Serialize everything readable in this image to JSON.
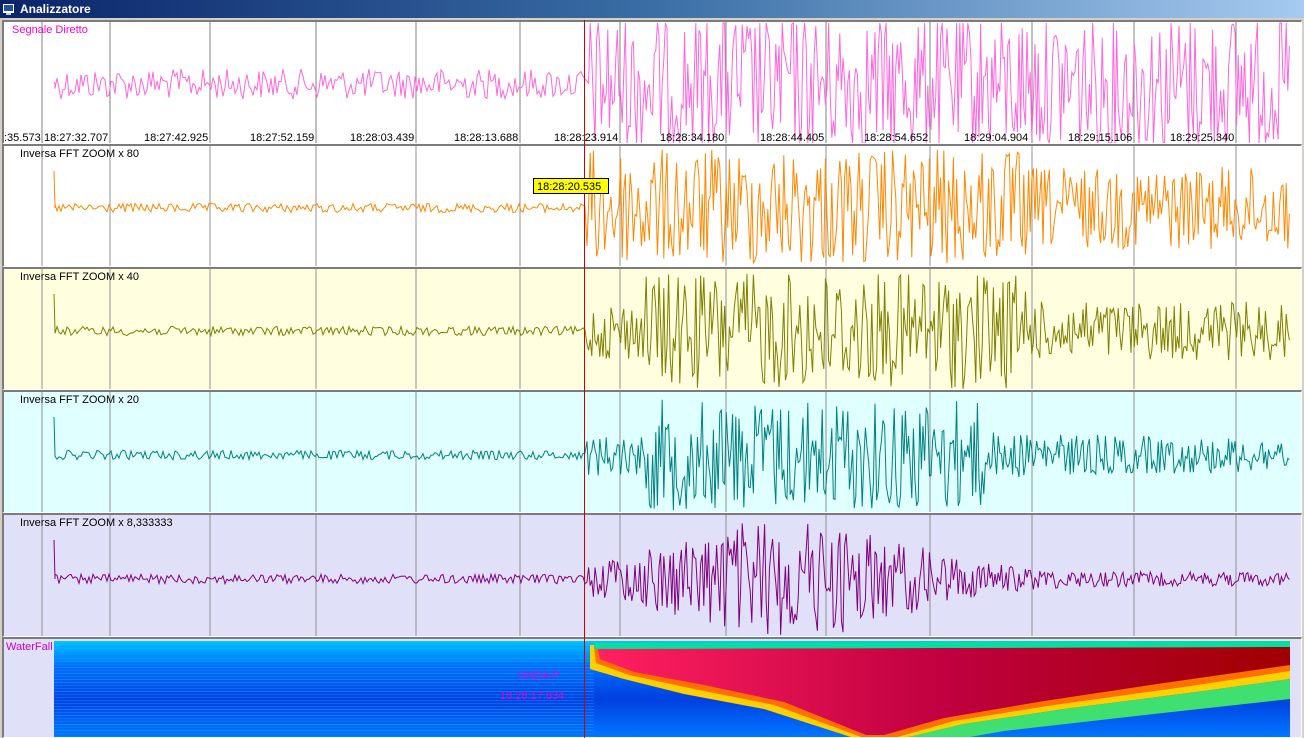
{
  "window": {
    "title": "Analizzatore"
  },
  "marker_time": "18:28:20.535",
  "time_axis": {
    "start_partial": ":35.573",
    "labels": [
      "18:27:32.707",
      "18:27:42.925",
      "18:27:52.159",
      "18:28:03.439",
      "18:28:13.688",
      "18:28:23.914",
      "18:28:34.180",
      "18:28:44.405",
      "18:28:54.652",
      "18:29:04.904",
      "18:29:15.106",
      "18:29:25.340"
    ]
  },
  "panels": [
    {
      "label": "Segnale Diretto",
      "color": "#ff66dd",
      "bg": "#ffffff"
    },
    {
      "label": "Inversa FFT ZOOM x 80",
      "color": "#ff8800",
      "bg": "#ffffff"
    },
    {
      "label": "Inversa FFT ZOOM x 40",
      "color": "#7f7f00",
      "bg": "#ffffe0"
    },
    {
      "label": "Inversa FFT ZOOM x 20",
      "color": "#008080",
      "bg": "#e0ffff"
    },
    {
      "label": "Inversa FFT ZOOM x 8,333333",
      "color": "#800080",
      "bg": "#e0e0f8"
    }
  ],
  "waterfall": {
    "label": "WaterFall",
    "wave_name": "ONDA P",
    "wave_time": "18:28:17.834"
  }
}
